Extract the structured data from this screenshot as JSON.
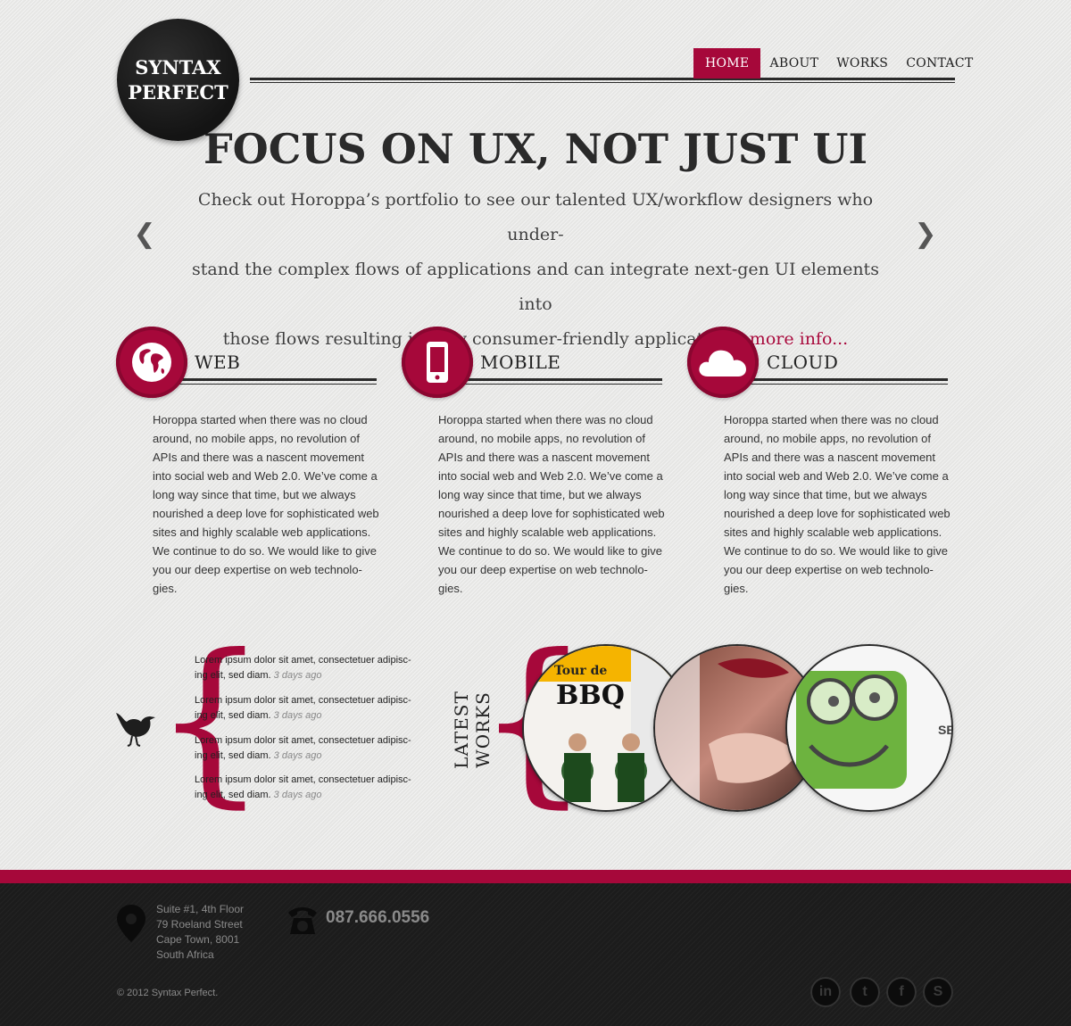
{
  "logo": {
    "line1": "SYNTAX",
    "line2": "PERFECT"
  },
  "nav": [
    {
      "label": "HOME",
      "active": true
    },
    {
      "label": "ABOUT",
      "active": false
    },
    {
      "label": "WORKS",
      "active": false
    },
    {
      "label": "CONTACT",
      "active": false
    }
  ],
  "hero": {
    "title": "FOCUS ON UX, NOT JUST UI",
    "line1": "Check out Horoppa’s portfolio to see our talented UX/workflow designers who under-",
    "line2": "stand the complex flows of applications and can integrate next-gen UI elements into",
    "line3": "those flows resulting in very consumer-friendly applications.",
    "more_link": "more info...",
    "prev_arrow": "❮",
    "next_arrow": "❯"
  },
  "services": [
    {
      "title": "WEB",
      "icon": "globe-icon",
      "text": "Horoppa started when there was no cloud around, no mobile apps, no revolution of APIs and there was a nascent movement into social web and Web 2.0. We’ve come a long way since that time, but we always nourished a deep love for sophisticated web sites and highly scalable web applications. We continue to do so. We would like to give you our deep expertise on web technolo-gies."
    },
    {
      "title": "MOBILE",
      "icon": "mobile-phone-icon",
      "text": "Horoppa started when there was no cloud around, no mobile apps, no revolution of APIs and there was a nascent movement into social web and Web 2.0. We’ve come a long way since that time, but we always nourished a deep love for sophisticated web sites and highly scalable web applications. We continue to do so. We would like to give you our deep expertise on web technolo-gies."
    },
    {
      "title": "CLOUD",
      "icon": "cloud-icon",
      "text": "Horoppa started when there was no cloud around, no mobile apps, no revolution of APIs and there was a nascent movement into social web and Web 2.0. We’ve come a long way since that time, but we always nourished a deep love for sophisticated web sites and highly scalable web applications. We continue to do so. We would like to give you our deep expertise on web technolo-gies."
    }
  ],
  "tweets": [
    {
      "text": "Lorem ipsum dolor sit amet, consectetuer adipisc-ing elit, sed diam.",
      "ago": "3 days ago"
    },
    {
      "text": "Lorem ipsum dolor sit amet, consectetuer adipisc-ing elit, sed diam.",
      "ago": "3 days ago"
    },
    {
      "text": "Lorem ipsum dolor sit amet, consectetuer adipisc-ing elit, sed diam.",
      "ago": "3 days ago"
    },
    {
      "text": "Lorem ipsum dolor sit amet, consectetuer adipisc-ing elit, sed diam.",
      "ago": "3 days ago"
    }
  ],
  "latest_works": {
    "label": "LATEST WORKS",
    "items": [
      {
        "name": "tour-de-bbq-work",
        "caption_top": "Tour de",
        "caption_main": "BBQ"
      },
      {
        "name": "beauty-work"
      },
      {
        "name": "green-character-work",
        "caption_main": "SE"
      }
    ]
  },
  "footer": {
    "address": [
      "Suite #1, 4th Floor",
      "79 Roeland Street",
      "Cape Town, 8001",
      "South Africa"
    ],
    "phone": "087.666.0556",
    "copyright": "© 2012 Syntax Perfect.",
    "social": [
      {
        "name": "linkedin-icon",
        "glyph": "in"
      },
      {
        "name": "twitter-icon",
        "glyph": "t"
      },
      {
        "name": "facebook-icon",
        "glyph": "f"
      },
      {
        "name": "skype-icon",
        "glyph": "S"
      }
    ]
  },
  "colors": {
    "accent": "#a6083a",
    "dark": "#1c1c1c",
    "text": "#333333"
  }
}
